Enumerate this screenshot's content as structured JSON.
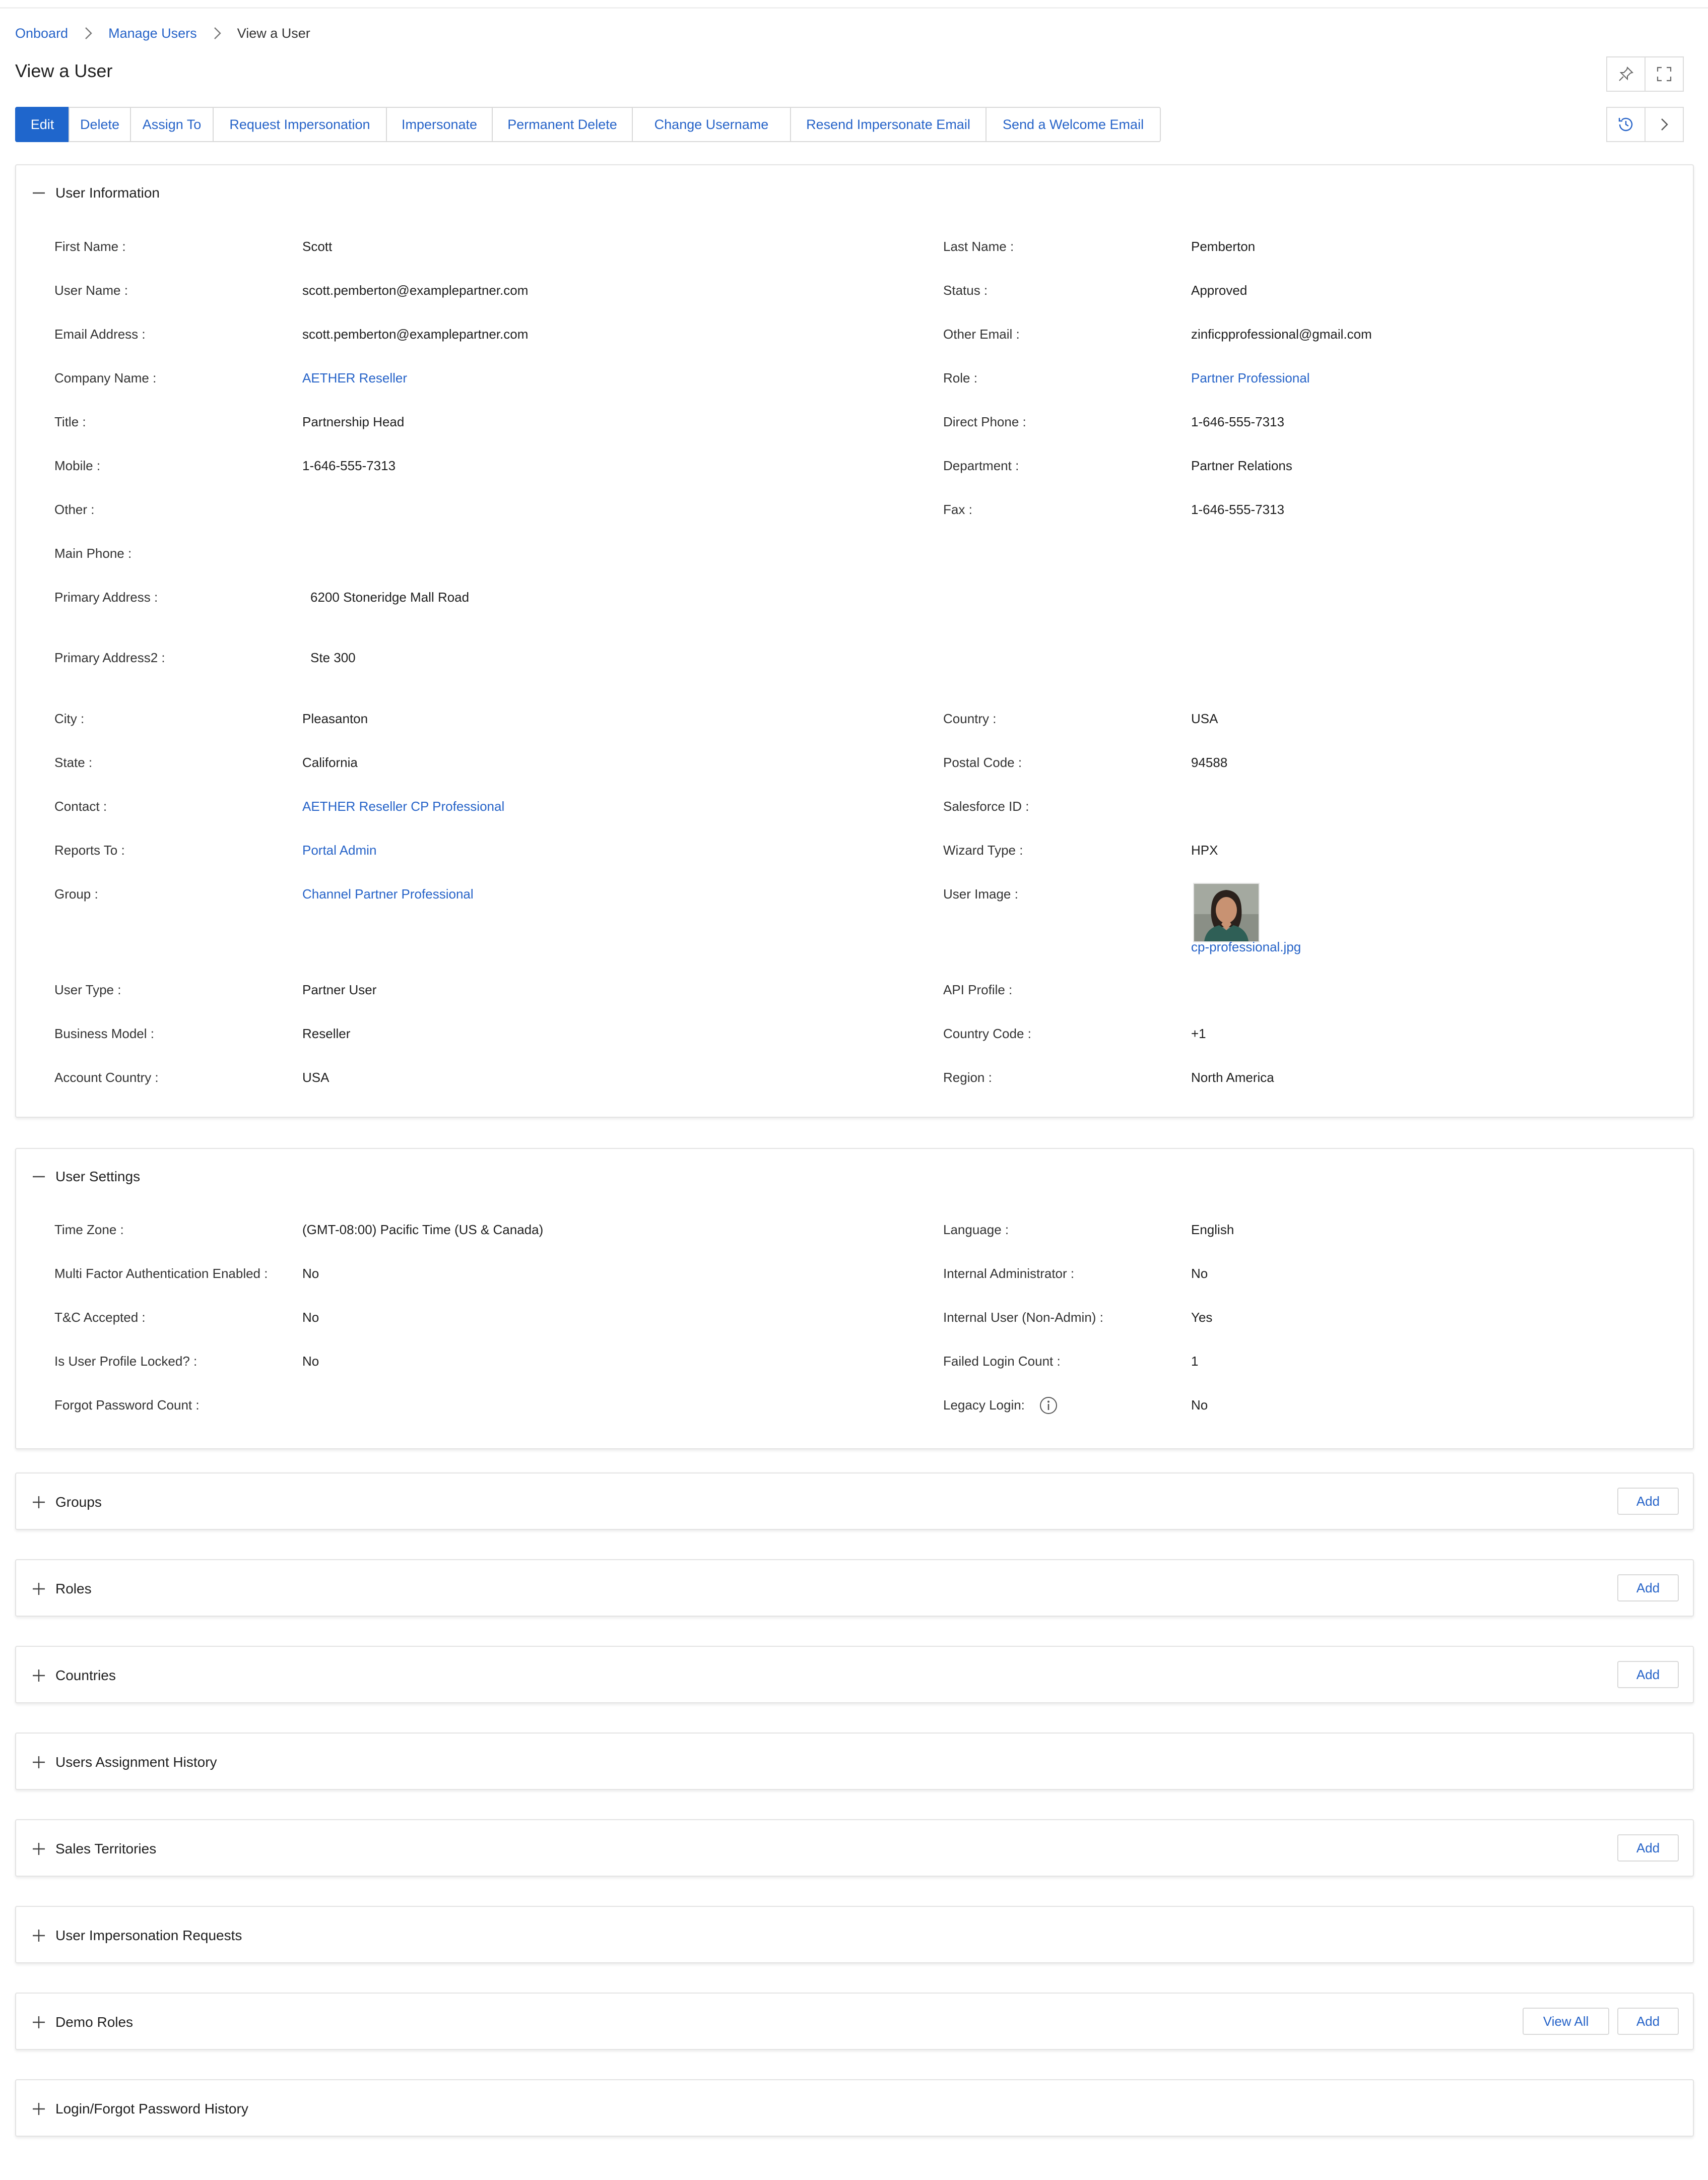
{
  "breadcrumb": {
    "items": [
      "Onboard",
      "Manage Users"
    ],
    "current": "View a User"
  },
  "page": {
    "title": "View a User"
  },
  "header_icons": {
    "pin": "pin-icon",
    "fullscreen": "fullscreen-icon",
    "history": "history-icon",
    "next": "chevron-right-icon"
  },
  "toolbar": {
    "edit": "Edit",
    "delete": "Delete",
    "assign_to": "Assign To",
    "request_impersonation": "Request Impersonation",
    "impersonate": "Impersonate",
    "permanent_delete": "Permanent Delete",
    "change_username": "Change Username",
    "resend_impersonate_email": "Resend Impersonate Email",
    "send_welcome_email": "Send a Welcome Email"
  },
  "user_info": {
    "title": "User Information",
    "first_name_label": "First Name :",
    "first_name": "Scott",
    "last_name_label": "Last Name :",
    "last_name": "Pemberton",
    "user_name_label": "User Name :",
    "user_name": "scott.pemberton@examplepartner.com",
    "status_label": "Status :",
    "status": "Approved",
    "email_label": "Email Address :",
    "email": "scott.pemberton@examplepartner.com",
    "other_email_label": "Other Email :",
    "other_email": "zinficpprofessional@gmail.com",
    "company_label": "Company Name :",
    "company": "AETHER Reseller",
    "role_label": "Role :",
    "role": "Partner Professional",
    "title_label": "Title :",
    "title_value": "Partnership Head",
    "direct_phone_label": "Direct Phone :",
    "direct_phone": "1-646-555-7313",
    "mobile_label": "Mobile :",
    "mobile": "1-646-555-7313",
    "department_label": "Department :",
    "department": "Partner Relations",
    "other_label": "Other :",
    "fax_label": "Fax :",
    "fax": "1-646-555-7313",
    "main_phone_label": "Main Phone :",
    "primary_address_label": "Primary Address :",
    "primary_address": "6200 Stoneridge Mall Road",
    "primary_address2_label": "Primary Address2 :",
    "primary_address2": "Ste 300",
    "city_label": "City :",
    "city": "Pleasanton",
    "country_label": "Country :",
    "country": "USA",
    "state_label": "State :",
    "state": "California",
    "postal_label": "Postal Code :",
    "postal": "94588",
    "contact_label": "Contact :",
    "contact": "AETHER Reseller CP Professional",
    "salesforce_label": "Salesforce ID :",
    "reports_to_label": "Reports To :",
    "reports_to": "Portal Admin",
    "wizard_label": "Wizard Type :",
    "wizard": "HPX",
    "group_label": "Group :",
    "group": "Channel Partner Professional",
    "user_image_label": "User Image :",
    "user_image_file": "cp-professional.jpg",
    "user_type_label": "User Type :",
    "user_type": "Partner User",
    "api_profile_label": "API Profile :",
    "business_model_label": "Business Model :",
    "business_model": "Reseller",
    "country_code_label": "Country Code :",
    "country_code": "+1",
    "account_country_label": "Account Country :",
    "account_country": "USA",
    "region_label": "Region :",
    "region": "North America"
  },
  "user_settings": {
    "title": "User Settings",
    "time_zone_label": "Time Zone :",
    "time_zone": "(GMT-08:00) Pacific Time (US & Canada)",
    "language_label": "Language :",
    "language": "English",
    "mfa_label": "Multi Factor Authentication Enabled :",
    "mfa": "No",
    "internal_admin_label": "Internal Administrator :",
    "internal_admin": "No",
    "tc_label": "T&C Accepted :",
    "tc": "No",
    "internal_user_label": "Internal User (Non-Admin) :",
    "internal_user": "Yes",
    "locked_label": "Is User Profile Locked? :",
    "locked": "No",
    "failed_login_label": "Failed Login Count :",
    "failed_login": "1",
    "forgot_pw_label": "Forgot Password Count :",
    "legacy_login_label": "Legacy Login:",
    "legacy_login": "No"
  },
  "sections": {
    "groups": "Groups",
    "roles": "Roles",
    "countries": "Countries",
    "assignment_history": "Users Assignment History",
    "sales_territories": "Sales Territories",
    "impersonation_requests": "User Impersonation Requests",
    "demo_roles": "Demo Roles",
    "login_history": "Login/Forgot Password History"
  },
  "actions": {
    "add": "Add",
    "view_all": "View All"
  }
}
